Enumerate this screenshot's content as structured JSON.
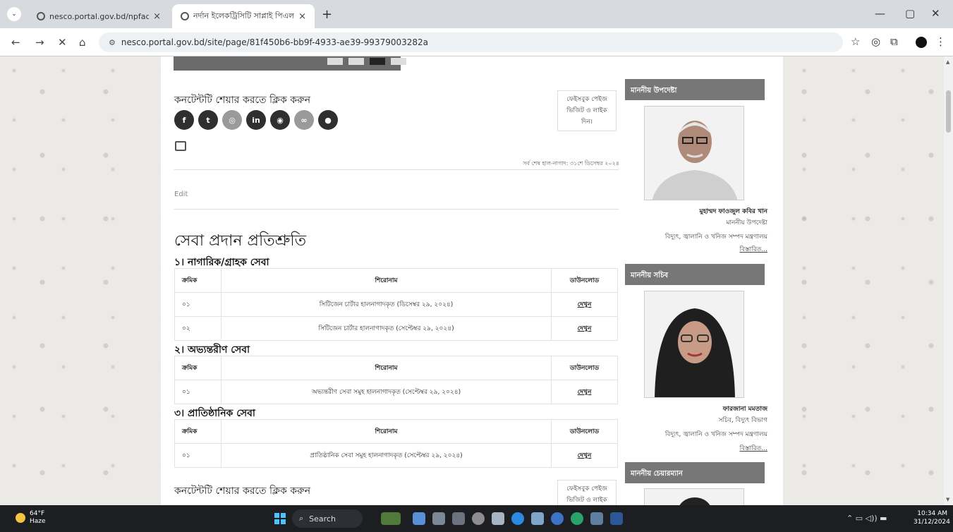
{
  "browser": {
    "tab_inactive_title": "nesco.portal.gov.bd/npfadmin",
    "tab_active_title": "নর্দান ইলেকট্রিসিটি সাপ্লাই পিএলসি",
    "url": "nesco.portal.gov.bd/site/page/81f450b6-bb9f-4933-ae39-99379003282a"
  },
  "share": {
    "title": "কনটেন্টটি শেয়ার করতে ক্লিক করুন",
    "fb_box": "ফেইসবুক পেইজ ভিজিট ও লাইক দিন।",
    "updated": "সর্ব শেষ হাল-নাগাদ: ৩১শে ডিসেম্বর ২০২৪",
    "edit": "Edit"
  },
  "main": {
    "heading": "সেবা প্রদান প্রতিশ্রুতি",
    "sections": [
      {
        "title": "১। নাগারিক/গ্রাহক সেবা",
        "headers": [
          "ক্রমিক",
          "শিরোনাম",
          "ডাউনলোড"
        ],
        "rows": [
          {
            "serial": "০১",
            "title": "সিটিজেন চার্টার হালনাগাদকৃত (ডিসেম্বর ২৯, ২০২৪)",
            "download": "দেখুন"
          },
          {
            "serial": "০২",
            "title": "সিটিজেন চার্টার হালনাগাদকৃত (সেপ্টেম্বর ২৯, ২০২৪)",
            "download": "দেখুন"
          }
        ]
      },
      {
        "title": "২। অভ্যন্তরীণ সেবা",
        "headers": [
          "ক্রমিক",
          "শিরোনাম",
          "ডাউনলোড"
        ],
        "rows": [
          {
            "serial": "০১",
            "title": "অভ্যন্তরীণ সেবা সমুহ হালনাগাদকৃত (সেপ্টেম্বর ২৯, ২০২৪)",
            "download": "দেখুন"
          }
        ]
      },
      {
        "title": "৩। প্রাতিষ্ঠানিক সেবা",
        "headers": [
          "ক্রমিক",
          "শিরোনাম",
          "ডাউনলোড"
        ],
        "rows": [
          {
            "serial": "০১",
            "title": "প্রাতিষ্ঠানিক সেবা সমুহ হালনাগাদকৃত (সেপ্টেম্বর ২৯, ২০২৪)",
            "download": "দেখুন"
          }
        ]
      }
    ]
  },
  "sidebar": {
    "advisor": {
      "heading": "মাননীয় উপদেষ্টা",
      "name": "মুহাম্মদ ফাওজুল কবির খান",
      "designation": "মাননীয় উপদেষ্টা",
      "ministry": "বিদ্যুৎ, জ্বালানি ও খনিজ সম্পদ মন্ত্রণালয়",
      "more": "বিস্তারিত..."
    },
    "secretary": {
      "heading": "মাননীয় সচিব",
      "name": "ফারজানা মমতাজ",
      "designation": "সচিব, বিদ্যুৎ বিভাগ",
      "ministry": "বিদ্যুৎ, জ্বালানি ও খনিজ সম্পদ মন্ত্রণালয়",
      "more": "বিস্তারিত..."
    },
    "chairman": {
      "heading": "মাননীয় চেয়ারম্যান"
    }
  },
  "taskbar": {
    "temp": "64°F",
    "weather": "Haze",
    "search": "Search",
    "time": "10:34 AM",
    "date": "31/12/2024"
  }
}
